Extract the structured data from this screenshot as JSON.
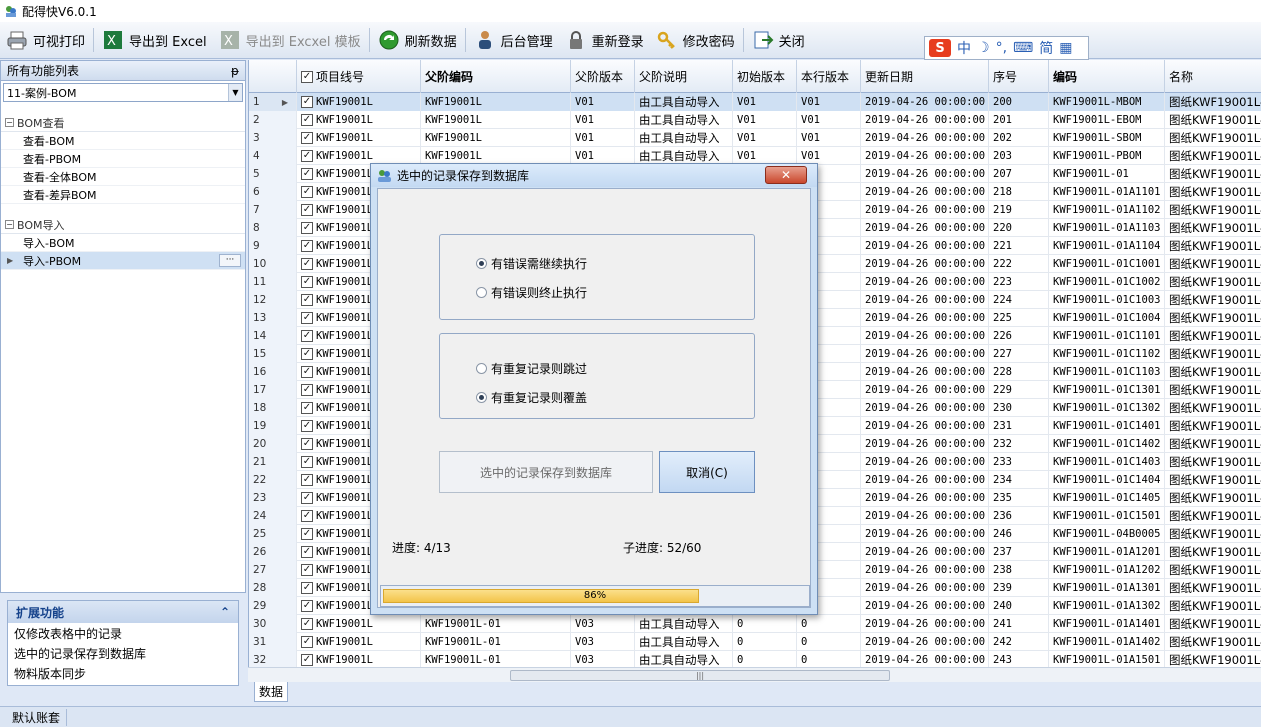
{
  "window": {
    "title": "配得快V6.0.1"
  },
  "toolbar": {
    "print": "可视打印",
    "export_excel": "导出到 Excel",
    "export_template": "导出到 Excxel 模板",
    "refresh": "刷新数据",
    "admin": "后台管理",
    "relogin": "重新登录",
    "change_password": "修改密码",
    "close": "关闭"
  },
  "ime": {
    "logo": "S",
    "mode": "中",
    "moon": "☽",
    "punct": "°,",
    "kbd": "⌨",
    "simp": "简",
    "grid": "▦"
  },
  "left_panel": {
    "header": "所有功能列表",
    "pin": "ᵽ",
    "combo_value": "11-案例-BOM",
    "groups": [
      {
        "title": "BOM查看",
        "items": [
          "查看-BOM",
          "查看-PBOM",
          "查看-全体BOM",
          "查看-差异BOM"
        ]
      },
      {
        "title": "BOM导入",
        "items": [
          "导入-BOM",
          "导入-PBOM"
        ]
      }
    ],
    "more": "···"
  },
  "extension": {
    "title": "扩展功能",
    "collapse": "⌃",
    "items": [
      "仅修改表格中的记录",
      "选中的记录保存到数据库",
      "物料版本同步"
    ]
  },
  "status": {
    "account": "默认账套"
  },
  "grid": {
    "columns": [
      "项目线号",
      "父阶编码",
      "父阶版本",
      "父阶说明",
      "初始版本",
      "本行版本",
      "更新日期",
      "序号",
      "编码",
      "名称"
    ],
    "rows": [
      [
        "1",
        "KWF19001L",
        "KWF19001L",
        "V01",
        "由工具自动导入",
        "V01",
        "V01",
        "2019-04-26 00:00:00",
        "200",
        "KWF19001L-MBOM",
        "图纸KWF19001L-M"
      ],
      [
        "2",
        "KWF19001L",
        "KWF19001L",
        "V01",
        "由工具自动导入",
        "V01",
        "V01",
        "2019-04-26 00:00:00",
        "201",
        "KWF19001L-EBOM",
        "图纸KWF19001L-E"
      ],
      [
        "3",
        "KWF19001L",
        "KWF19001L",
        "V01",
        "由工具自动导入",
        "V01",
        "V01",
        "2019-04-26 00:00:00",
        "202",
        "KWF19001L-SBOM",
        "图纸KWF19001L-S"
      ],
      [
        "4",
        "KWF19001L",
        "KWF19001L",
        "V01",
        "由工具自动导入",
        "V01",
        "V01",
        "2019-04-26 00:00:00",
        "203",
        "KWF19001L-PBOM",
        "图纸KWF19001L-P"
      ],
      [
        "5",
        "KWF19001L",
        "",
        "",
        "",
        "",
        "",
        "2019-04-26 00:00:00",
        "207",
        "KWF19001L-01",
        "图纸KWF19001L-0"
      ],
      [
        "6",
        "KWF19001L",
        "",
        "",
        "",
        "",
        "",
        "2019-04-26 00:00:00",
        "218",
        "KWF19001L-01A1101",
        "图纸KWF19001L-0"
      ],
      [
        "7",
        "KWF19001L",
        "",
        "",
        "",
        "",
        "",
        "2019-04-26 00:00:00",
        "219",
        "KWF19001L-01A1102",
        "图纸KWF19001L-0"
      ],
      [
        "8",
        "KWF19001L",
        "",
        "",
        "",
        "",
        "",
        "2019-04-26 00:00:00",
        "220",
        "KWF19001L-01A1103",
        "图纸KWF19001L-0"
      ],
      [
        "9",
        "KWF19001L",
        "",
        "",
        "",
        "",
        "",
        "2019-04-26 00:00:00",
        "221",
        "KWF19001L-01A1104",
        "图纸KWF19001L-0"
      ],
      [
        "10",
        "KWF19001L",
        "",
        "",
        "",
        "",
        "",
        "2019-04-26 00:00:00",
        "222",
        "KWF19001L-01C1001",
        "图纸KWF19001L-0"
      ],
      [
        "11",
        "KWF19001L",
        "",
        "",
        "",
        "",
        "",
        "2019-04-26 00:00:00",
        "223",
        "KWF19001L-01C1002",
        "图纸KWF19001L-0"
      ],
      [
        "12",
        "KWF19001L",
        "",
        "",
        "",
        "",
        "",
        "2019-04-26 00:00:00",
        "224",
        "KWF19001L-01C1003",
        "图纸KWF19001L-0"
      ],
      [
        "13",
        "KWF19001L",
        "",
        "",
        "",
        "",
        "",
        "2019-04-26 00:00:00",
        "225",
        "KWF19001L-01C1004",
        "图纸KWF19001L-0"
      ],
      [
        "14",
        "KWF19001L",
        "",
        "",
        "",
        "",
        "",
        "2019-04-26 00:00:00",
        "226",
        "KWF19001L-01C1101",
        "图纸KWF19001L-0"
      ],
      [
        "15",
        "KWF19001L",
        "",
        "",
        "",
        "",
        "",
        "2019-04-26 00:00:00",
        "227",
        "KWF19001L-01C1102",
        "图纸KWF19001L-0"
      ],
      [
        "16",
        "KWF19001L",
        "",
        "",
        "",
        "",
        "",
        "2019-04-26 00:00:00",
        "228",
        "KWF19001L-01C1103",
        "图纸KWF19001L-0"
      ],
      [
        "17",
        "KWF19001L",
        "",
        "",
        "",
        "",
        "",
        "2019-04-26 00:00:00",
        "229",
        "KWF19001L-01C1301",
        "图纸KWF19001L-0"
      ],
      [
        "18",
        "KWF19001L",
        "",
        "",
        "",
        "",
        "",
        "2019-04-26 00:00:00",
        "230",
        "KWF19001L-01C1302",
        "图纸KWF19001L-0"
      ],
      [
        "19",
        "KWF19001L",
        "",
        "",
        "",
        "",
        "",
        "2019-04-26 00:00:00",
        "231",
        "KWF19001L-01C1401",
        "图纸KWF19001L-0"
      ],
      [
        "20",
        "KWF19001L",
        "",
        "",
        "",
        "",
        "",
        "2019-04-26 00:00:00",
        "232",
        "KWF19001L-01C1402",
        "图纸KWF19001L-0"
      ],
      [
        "21",
        "KWF19001L",
        "",
        "",
        "",
        "",
        "",
        "2019-04-26 00:00:00",
        "233",
        "KWF19001L-01C1403",
        "图纸KWF19001L-0"
      ],
      [
        "22",
        "KWF19001L",
        "",
        "",
        "",
        "",
        "",
        "2019-04-26 00:00:00",
        "234",
        "KWF19001L-01C1404",
        "图纸KWF19001L-0"
      ],
      [
        "23",
        "KWF19001L",
        "",
        "",
        "",
        "",
        "",
        "2019-04-26 00:00:00",
        "235",
        "KWF19001L-01C1405",
        "图纸KWF19001L-0"
      ],
      [
        "24",
        "KWF19001L",
        "",
        "",
        "",
        "",
        "",
        "2019-04-26 00:00:00",
        "236",
        "KWF19001L-01C1501",
        "图纸KWF19001L-0"
      ],
      [
        "25",
        "KWF19001L",
        "",
        "",
        "",
        "",
        "",
        "2019-04-26 00:00:00",
        "246",
        "KWF19001L-04B0005",
        "图纸KWF19001L-0"
      ],
      [
        "26",
        "KWF19001L",
        "",
        "",
        "",
        "",
        "",
        "2019-04-26 00:00:00",
        "237",
        "KWF19001L-01A1201",
        "图纸KWF19001L-0"
      ],
      [
        "27",
        "KWF19001L",
        "",
        "",
        "",
        "",
        "",
        "2019-04-26 00:00:00",
        "238",
        "KWF19001L-01A1202",
        "图纸KWF19001L-0"
      ],
      [
        "28",
        "KWF19001L",
        "",
        "",
        "",
        "",
        "",
        "2019-04-26 00:00:00",
        "239",
        "KWF19001L-01A1301",
        "图纸KWF19001L-0"
      ],
      [
        "29",
        "KWF19001L",
        "",
        "",
        "",
        "",
        "",
        "2019-04-26 00:00:00",
        "240",
        "KWF19001L-01A1302",
        "图纸KWF19001L-0"
      ],
      [
        "30",
        "KWF19001L",
        "KWF19001L-01",
        "V03",
        "由工具自动导入",
        "0",
        "0",
        "2019-04-26 00:00:00",
        "241",
        "KWF19001L-01A1401",
        "图纸KWF19001L-0"
      ],
      [
        "31",
        "KWF19001L",
        "KWF19001L-01",
        "V03",
        "由工具自动导入",
        "0",
        "0",
        "2019-04-26 00:00:00",
        "242",
        "KWF19001L-01A1402",
        "图纸KWF19001L-0"
      ],
      [
        "32",
        "KWF19001L",
        "KWF19001L-01",
        "V03",
        "由工具自动导入",
        "0",
        "0",
        "2019-04-26 00:00:00",
        "243",
        "KWF19001L-01A1501",
        "图纸KWF19001L-0"
      ]
    ],
    "check": "✓",
    "scroll_grip": "|||",
    "tab": "数据"
  },
  "dialog": {
    "title": "选中的记录保存到数据库",
    "close": "✕",
    "error_continue": "有错误需继续执行",
    "error_stop": "有错误则终止执行",
    "dup_skip": "有重复记录则跳过",
    "dup_overwrite": "有重复记录则覆盖",
    "save_button": "选中的记录保存到数据库",
    "cancel_button": "取消(C)",
    "progress_label": "进度: 4/13",
    "sub_progress_label": "子进度: 52/60",
    "progress_text": "86%",
    "progress_value": 0.86
  }
}
